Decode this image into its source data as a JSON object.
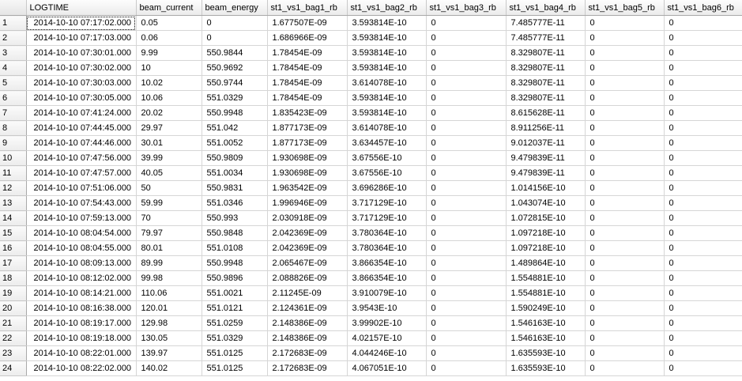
{
  "grid": {
    "columns": [
      "LOGTIME",
      "beam_current",
      "beam_energy",
      "st1_vs1_bag1_rb",
      "st1_vs1_bag2_rb",
      "st1_vs1_bag3_rb",
      "st1_vs1_bag4_rb",
      "st1_vs1_bag5_rb",
      "st1_vs1_bag6_rb"
    ],
    "rows": [
      {
        "n": "1",
        "cells": [
          "2014-10-10 07:17:02.000",
          "0.05",
          "0",
          "1.677507E-09",
          "3.593814E-10",
          "0",
          "7.485777E-11",
          "0",
          "0"
        ]
      },
      {
        "n": "2",
        "cells": [
          "2014-10-10 07:17:03.000",
          "0.06",
          "0",
          "1.686966E-09",
          "3.593814E-10",
          "0",
          "7.485777E-11",
          "0",
          "0"
        ]
      },
      {
        "n": "3",
        "cells": [
          "2014-10-10 07:30:01.000",
          "9.99",
          "550.9844",
          "1.78454E-09",
          "3.593814E-10",
          "0",
          "8.329807E-11",
          "0",
          "0"
        ]
      },
      {
        "n": "4",
        "cells": [
          "2014-10-10 07:30:02.000",
          "10",
          "550.9692",
          "1.78454E-09",
          "3.593814E-10",
          "0",
          "8.329807E-11",
          "0",
          "0"
        ]
      },
      {
        "n": "5",
        "cells": [
          "2014-10-10 07:30:03.000",
          "10.02",
          "550.9744",
          "1.78454E-09",
          "3.614078E-10",
          "0",
          "8.329807E-11",
          "0",
          "0"
        ]
      },
      {
        "n": "6",
        "cells": [
          "2014-10-10 07:30:05.000",
          "10.06",
          "551.0329",
          "1.78454E-09",
          "3.593814E-10",
          "0",
          "8.329807E-11",
          "0",
          "0"
        ]
      },
      {
        "n": "7",
        "cells": [
          "2014-10-10 07:41:24.000",
          "20.02",
          "550.9948",
          "1.835423E-09",
          "3.593814E-10",
          "0",
          "8.615628E-11",
          "0",
          "0"
        ]
      },
      {
        "n": "8",
        "cells": [
          "2014-10-10 07:44:45.000",
          "29.97",
          "551.042",
          "1.877173E-09",
          "3.614078E-10",
          "0",
          "8.911256E-11",
          "0",
          "0"
        ]
      },
      {
        "n": "9",
        "cells": [
          "2014-10-10 07:44:46.000",
          "30.01",
          "551.0052",
          "1.877173E-09",
          "3.634457E-10",
          "0",
          "9.012037E-11",
          "0",
          "0"
        ]
      },
      {
        "n": "10",
        "cells": [
          "2014-10-10 07:47:56.000",
          "39.99",
          "550.9809",
          "1.930698E-09",
          "3.67556E-10",
          "0",
          "9.479839E-11",
          "0",
          "0"
        ]
      },
      {
        "n": "11",
        "cells": [
          "2014-10-10 07:47:57.000",
          "40.05",
          "551.0034",
          "1.930698E-09",
          "3.67556E-10",
          "0",
          "9.479839E-11",
          "0",
          "0"
        ]
      },
      {
        "n": "12",
        "cells": [
          "2014-10-10 07:51:06.000",
          "50",
          "550.9831",
          "1.963542E-09",
          "3.696286E-10",
          "0",
          "1.014156E-10",
          "0",
          "0"
        ]
      },
      {
        "n": "13",
        "cells": [
          "2014-10-10 07:54:43.000",
          "59.99",
          "551.0346",
          "1.996946E-09",
          "3.717129E-10",
          "0",
          "1.043074E-10",
          "0",
          "0"
        ]
      },
      {
        "n": "14",
        "cells": [
          "2014-10-10 07:59:13.000",
          "70",
          "550.993",
          "2.030918E-09",
          "3.717129E-10",
          "0",
          "1.072815E-10",
          "0",
          "0"
        ]
      },
      {
        "n": "15",
        "cells": [
          "2014-10-10 08:04:54.000",
          "79.97",
          "550.9848",
          "2.042369E-09",
          "3.780364E-10",
          "0",
          "1.097218E-10",
          "0",
          "0"
        ]
      },
      {
        "n": "16",
        "cells": [
          "2014-10-10 08:04:55.000",
          "80.01",
          "551.0108",
          "2.042369E-09",
          "3.780364E-10",
          "0",
          "1.097218E-10",
          "0",
          "0"
        ]
      },
      {
        "n": "17",
        "cells": [
          "2014-10-10 08:09:13.000",
          "89.99",
          "550.9948",
          "2.065467E-09",
          "3.866354E-10",
          "0",
          "1.489864E-10",
          "0",
          "0"
        ]
      },
      {
        "n": "18",
        "cells": [
          "2014-10-10 08:12:02.000",
          "99.98",
          "550.9896",
          "2.088826E-09",
          "3.866354E-10",
          "0",
          "1.554881E-10",
          "0",
          "0"
        ]
      },
      {
        "n": "19",
        "cells": [
          "2014-10-10 08:14:21.000",
          "110.06",
          "551.0021",
          "2.11245E-09",
          "3.910079E-10",
          "0",
          "1.554881E-10",
          "0",
          "0"
        ]
      },
      {
        "n": "20",
        "cells": [
          "2014-10-10 08:16:38.000",
          "120.01",
          "551.0121",
          "2.124361E-09",
          "3.9543E-10",
          "0",
          "1.590249E-10",
          "0",
          "0"
        ]
      },
      {
        "n": "21",
        "cells": [
          "2014-10-10 08:19:17.000",
          "129.98",
          "551.0259",
          "2.148386E-09",
          "3.99902E-10",
          "0",
          "1.546163E-10",
          "0",
          "0"
        ]
      },
      {
        "n": "22",
        "cells": [
          "2014-10-10 08:19:18.000",
          "130.05",
          "551.0329",
          "2.148386E-09",
          "4.02157E-10",
          "0",
          "1.546163E-10",
          "0",
          "0"
        ]
      },
      {
        "n": "23",
        "cells": [
          "2014-10-10 08:22:01.000",
          "139.97",
          "551.0125",
          "2.172683E-09",
          "4.044246E-10",
          "0",
          "1.635593E-10",
          "0",
          "0"
        ]
      },
      {
        "n": "24",
        "cells": [
          "2014-10-10 08:22:02.000",
          "140.02",
          "551.0125",
          "2.172683E-09",
          "4.067051E-10",
          "0",
          "1.635593E-10",
          "0",
          "0"
        ]
      }
    ]
  }
}
